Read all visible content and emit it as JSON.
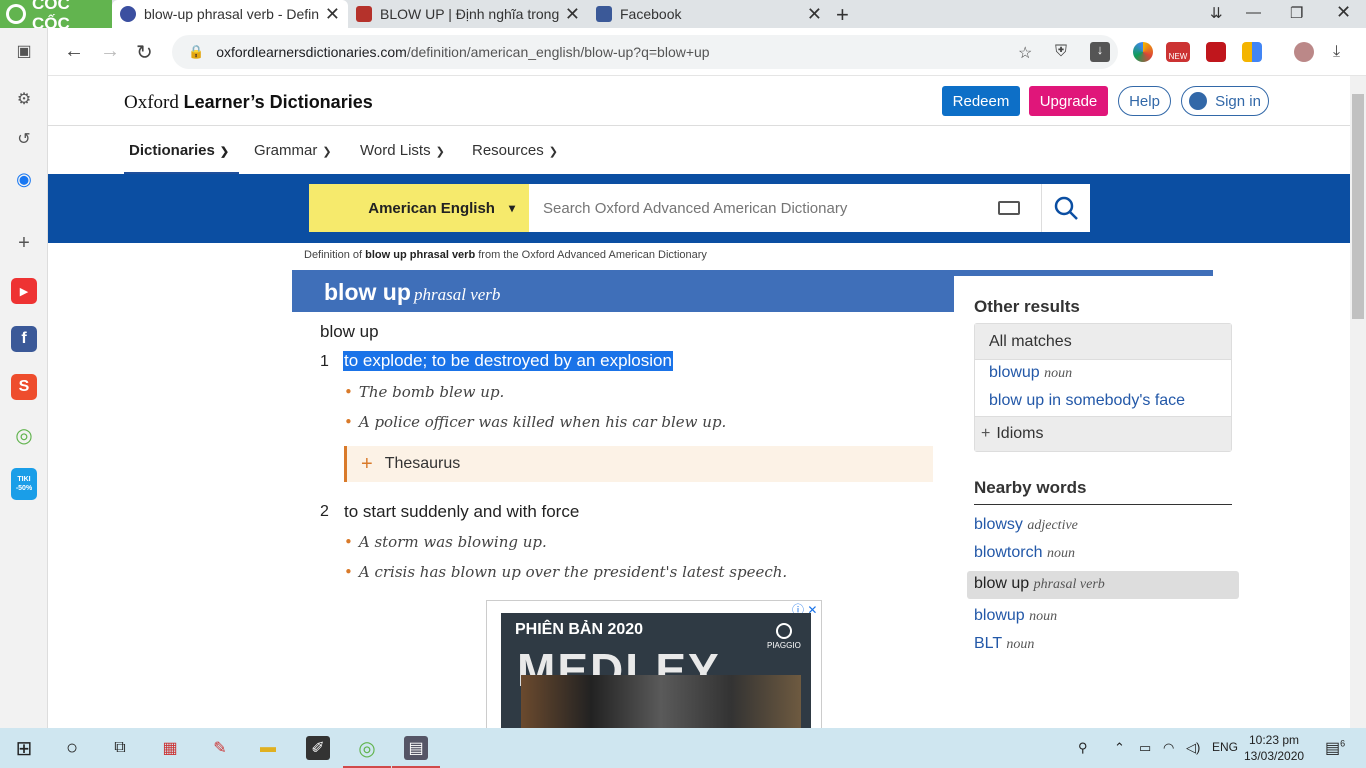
{
  "browser": {
    "logo_text": "CỐC CỐC",
    "tabs": [
      {
        "title": "blow-up phrasal verb - Defini",
        "color": "#3b4fa0"
      },
      {
        "title": "BLOW UP | Định nghĩa trong",
        "color": "#b5322b"
      },
      {
        "title": "Facebook",
        "color": "#3b5998"
      }
    ],
    "url_domain": "oxfordlearnersdictionaries.com",
    "url_path": "/definition/american_english/blow-up?q=blow+up",
    "ext_new_badge": "NEW"
  },
  "sidebar": {
    "tiki_badge": "TIKI -50%"
  },
  "site": {
    "logo_oxford": "Oxford",
    "logo_rest": "Learner’s Dictionaries",
    "redeem": "Redeem",
    "upgrade": "Upgrade",
    "help": "Help",
    "sign_in": "Sign in",
    "menu": [
      "Dictionaries",
      "Grammar",
      "Word Lists",
      "Resources"
    ],
    "dictionary_select": "American English",
    "search_placeholder": "Search Oxford Advanced American Dictionary"
  },
  "entry": {
    "crumb_prefix": "Definition of",
    "crumb_bold": "blow up phrasal verb",
    "crumb_suffix": "from the Oxford Advanced American Dictionary",
    "headword": "blow up",
    "pos": "phrasal verb",
    "sub_headword": "blow up",
    "senses": [
      {
        "num": "1",
        "def": "to explode; to be destroyed by an explosion",
        "examples": [
          "The bomb blew up.",
          "A police officer was killed when his car blew up."
        ]
      },
      {
        "num": "2",
        "def": "to start suddenly and with force",
        "examples": [
          "A storm was blowing up.",
          "A crisis has blown up over the president's latest speech."
        ]
      }
    ],
    "thesaurus": "Thesaurus"
  },
  "ad": {
    "headline": "PHIÊN BẢN 2020",
    "title": "MEDLEY",
    "brand": "PIAGGIO"
  },
  "side": {
    "other_results": "Other results",
    "all_matches": "All matches",
    "matches": [
      {
        "word": "blowup",
        "pos": "noun"
      },
      {
        "word": "blow up in somebody's face",
        "pos": ""
      }
    ],
    "idioms": "Idioms",
    "nearby_heading": "Nearby words",
    "nearby": [
      {
        "word": "blowsy",
        "pos": "adjective"
      },
      {
        "word": "blowtorch",
        "pos": "noun"
      },
      {
        "word": "blow up",
        "pos": "phrasal verb"
      },
      {
        "word": "blowup",
        "pos": "noun"
      },
      {
        "word": "BLT",
        "pos": "noun"
      }
    ]
  },
  "taskbar": {
    "lang": "ENG",
    "time": "10:23 pm",
    "date": "13/03/2020",
    "notif_count": "6"
  },
  "colors": {
    "brand_blue": "#0b4ea2",
    "redeem": "#0d6fc7",
    "upgrade": "#e0167a",
    "accent_orange": "#d97a2a",
    "coccoc_green": "#62b44f"
  }
}
